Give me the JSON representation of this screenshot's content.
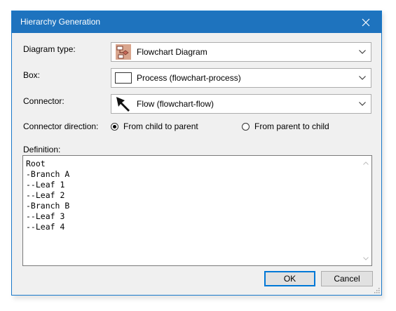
{
  "window": {
    "title": "Hierarchy Generation"
  },
  "fields": {
    "diagram_type_label": "Diagram type:",
    "diagram_type_value": "Flowchart Diagram",
    "box_label": "Box:",
    "box_value": "Process (flowchart-process)",
    "connector_label": "Connector:",
    "connector_value": "Flow (flowchart-flow)",
    "direction_label": "Connector direction:",
    "direction_options": [
      {
        "label": "From child to parent",
        "selected": true
      },
      {
        "label": "From parent to child",
        "selected": false
      }
    ],
    "definition_label": "Definition:",
    "definition_lines": [
      "Root",
      "-Branch A",
      "--Leaf 1",
      "--Leaf 2",
      "-Branch B",
      "--Leaf 3",
      "--Leaf 4"
    ]
  },
  "buttons": {
    "ok": "OK",
    "cancel": "Cancel"
  },
  "icons": {
    "close": "close-icon",
    "diagram": "flowchart-diagram-icon",
    "box": "process-box-icon",
    "connector": "arrow-connector-icon",
    "dropdown": "chevron-down-icon"
  },
  "colors": {
    "titlebar": "#1e73be",
    "ok_border": "#0078d7"
  }
}
